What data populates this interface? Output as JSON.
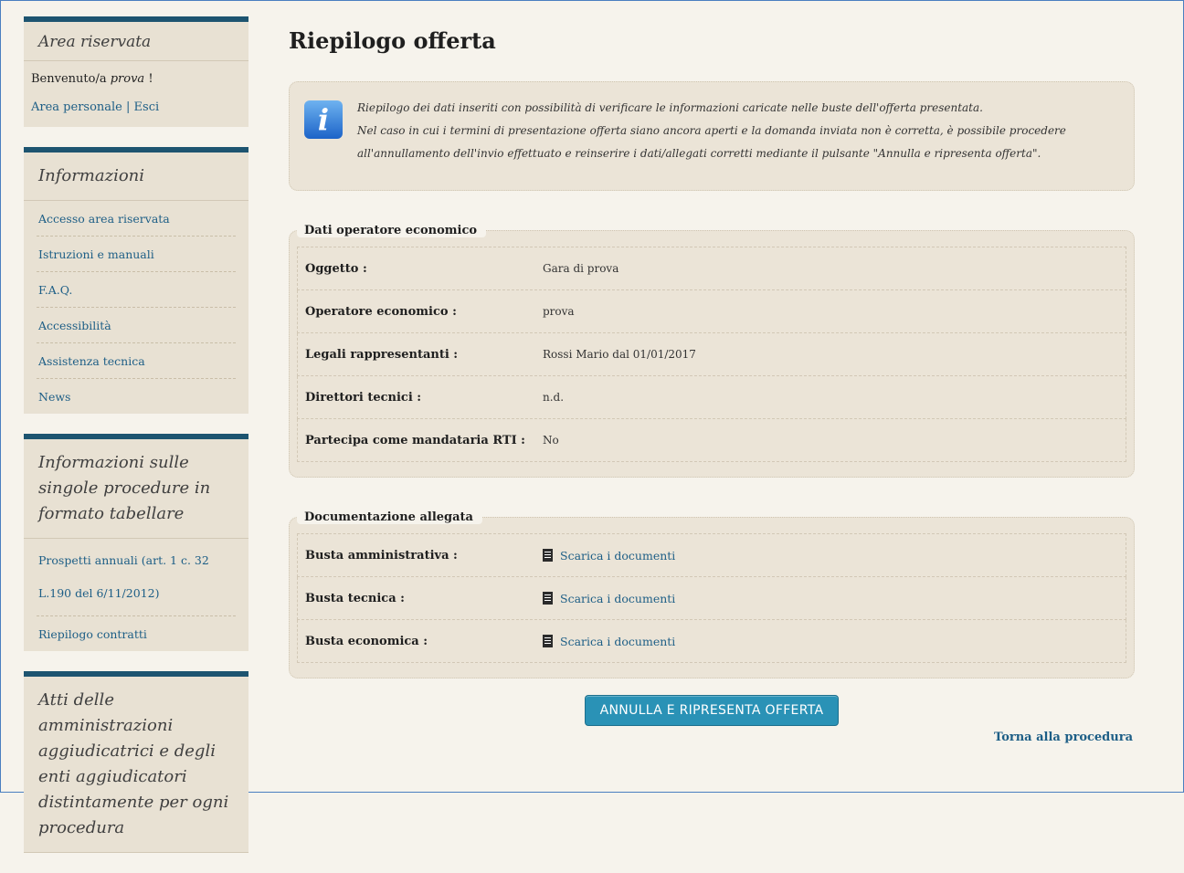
{
  "sidebar": {
    "reserved_title": "Area riservata",
    "welcome_prefix": "Benvenuto/a ",
    "welcome_user": "prova",
    "welcome_suffix": " !",
    "personal_area": "Area personale",
    "separator": " | ",
    "logout": "Esci",
    "info_title": "Informazioni",
    "info_items": [
      "Accesso area riservata",
      "Istruzioni e manuali",
      "F.A.Q.",
      "Accessibilità",
      "Assistenza tecnica",
      "News"
    ],
    "procedures_title": "Informazioni sulle singole procedure in formato tabellare",
    "procedures_items": [
      "Prospetti annuali (art. 1 c. 32 L.190 del 6/11/2012)",
      "Riepilogo contratti"
    ],
    "acts_title": "Atti delle amministrazioni aggiudicatrici e degli enti aggiudicatori distintamente per ogni procedura"
  },
  "main": {
    "title": "Riepilogo offerta",
    "info_line1": "Riepilogo dei dati inseriti con possibilità di verificare le informazioni caricate nelle buste dell'offerta presentata.",
    "info_line2": "Nel caso in cui i termini di presentazione offerta siano ancora aperti e la domanda inviata non è corretta, è possibile procedere all'annullamento dell'invio effettuato e reinserire i dati/allegati corretti mediante il pulsante \"Annulla e ripresenta offerta\".",
    "operator_legend": "Dati operatore economico",
    "operator_rows": [
      {
        "label": "Oggetto :",
        "value": "Gara di prova"
      },
      {
        "label": "Operatore economico :",
        "value": "prova"
      },
      {
        "label": "Legali rappresentanti :",
        "value": "Rossi Mario dal 01/01/2017"
      },
      {
        "label": "Direttori tecnici :",
        "value": "n.d."
      },
      {
        "label": "Partecipa come mandataria RTI :",
        "value": "No"
      }
    ],
    "docs_legend": "Documentazione allegata",
    "doc_rows": [
      {
        "label": "Busta amministrativa :",
        "link": "Scarica i documenti"
      },
      {
        "label": "Busta tecnica :",
        "link": "Scarica i documenti"
      },
      {
        "label": "Busta economica :",
        "link": "Scarica i documenti"
      }
    ],
    "button": "ANNULLA E RIPRESENTA OFFERTA",
    "back": "Torna alla procedura"
  },
  "colors": {
    "accent": "#1d5470",
    "link": "#1d5e86",
    "button": "#2a92b6",
    "panel": "#ebe4d7"
  }
}
